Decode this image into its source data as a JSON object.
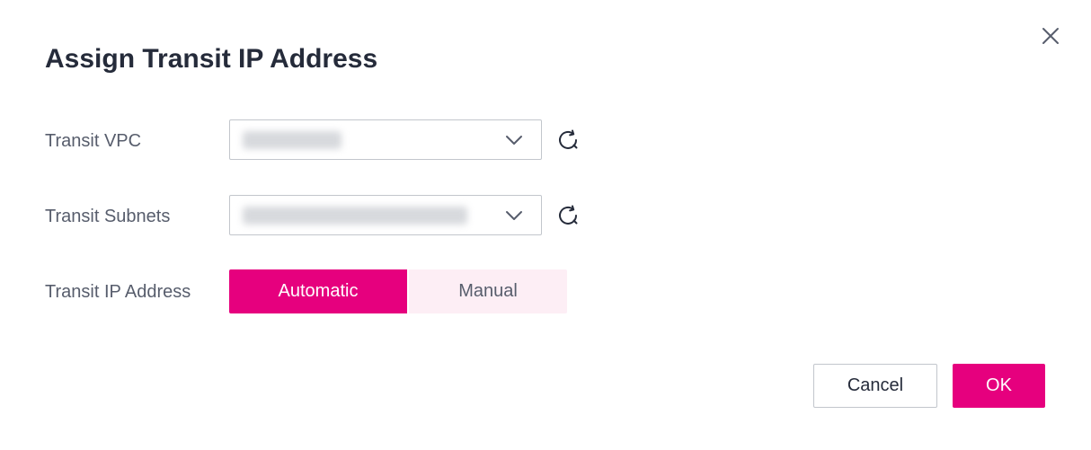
{
  "dialog": {
    "title": "Assign Transit IP Address",
    "close_icon": "close-icon"
  },
  "form": {
    "vpc": {
      "label": "Transit VPC",
      "value": "vpc-xxx",
      "icon": "chevron-down-icon",
      "refresh_icon": "refresh-icon"
    },
    "subnets": {
      "label": "Transit Subnets",
      "value": "subnet-xxxxxxxxxxxxx",
      "icon": "chevron-down-icon",
      "refresh_icon": "refresh-icon"
    },
    "ip_address": {
      "label": "Transit IP Address",
      "options": [
        "Automatic",
        "Manual"
      ],
      "selected": "Automatic"
    }
  },
  "footer": {
    "cancel_label": "Cancel",
    "ok_label": "OK"
  },
  "colors": {
    "accent": "#e6007e",
    "accent_light": "#fdeef5",
    "text_primary": "#252b3a",
    "text_secondary": "#575d6c",
    "border": "#c2c6cc"
  }
}
